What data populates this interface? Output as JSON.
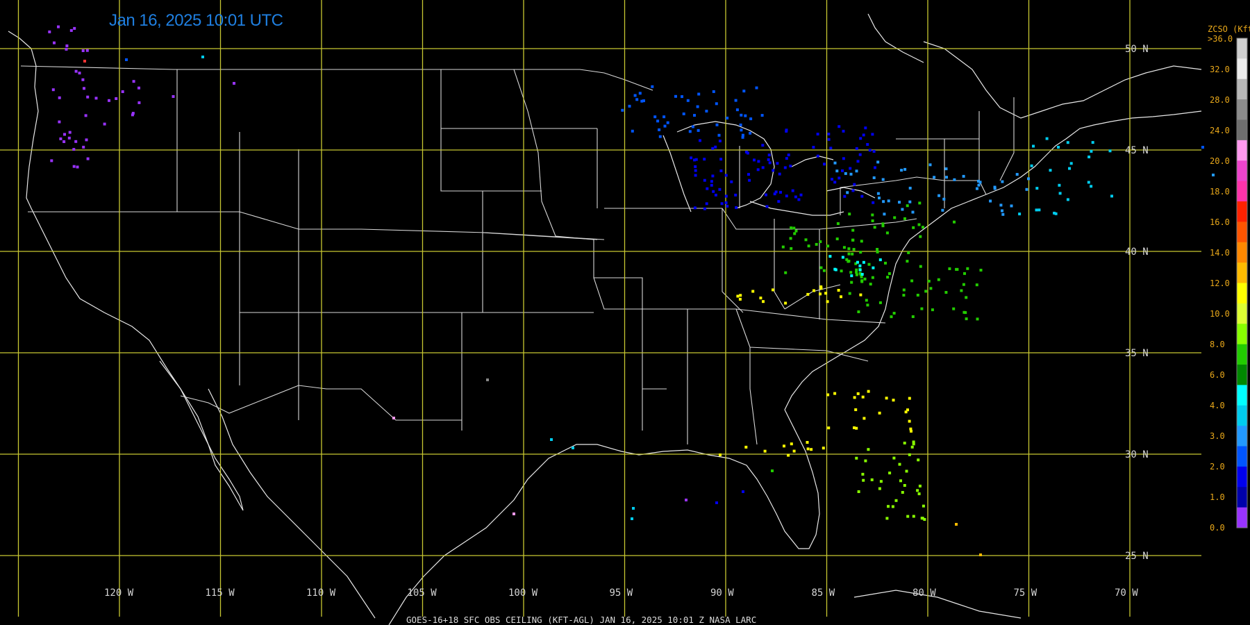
{
  "title": "Jan 16, 2025 10:01 UTC",
  "footer": "GOES-16+18  SFC OBS CEILING (KFT-AGL)   JAN 16, 2025 10:01 Z   NASA LARC",
  "lat_labels": [
    "50 N",
    "45 N",
    "40 N",
    "35 N",
    "30 N",
    "25 N"
  ],
  "lon_labels": [
    "120 W",
    "115 W",
    "110 W",
    "105 W",
    "100 W",
    "95 W",
    "90 W",
    "85 W",
    "80 W",
    "75 W",
    "70 W"
  ],
  "colorbar": {
    "units": "ZCSO (Kft)",
    "top_label": ">36.0",
    "labels": [
      "32.0",
      "28.0",
      "24.0",
      "20.0",
      "18.0",
      "16.0",
      "14.0",
      "12.0",
      "10.0",
      "8.0",
      "6.0",
      "4.0",
      "3.0",
      "2.0",
      "1.0",
      "0.0"
    ],
    "colors": [
      "#d0d0d0",
      "#ececec",
      "#b8b8b8",
      "#8c8c8c",
      "#6e6e6e",
      "#ff99ee",
      "#ee44cc",
      "#ff33aa",
      "#ff2200",
      "#ff5500",
      "#ff8800",
      "#ffbb00",
      "#ffff00",
      "#ddff33",
      "#88ff00",
      "#22cc00",
      "#008800",
      "#00ffff",
      "#00ccee",
      "#2299ff",
      "#0055ff",
      "#0000ee",
      "#0000aa",
      "#9933ff"
    ]
  }
}
